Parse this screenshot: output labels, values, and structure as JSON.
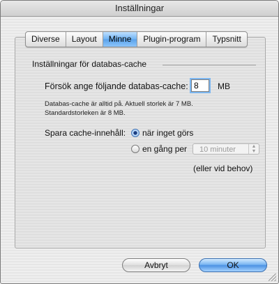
{
  "window": {
    "title": "Inställningar"
  },
  "tabs": [
    {
      "label": "Diverse",
      "active": false
    },
    {
      "label": "Layout",
      "active": false
    },
    {
      "label": "Minne",
      "active": true
    },
    {
      "label": "Plugin-program",
      "active": false
    },
    {
      "label": "Typsnitt",
      "active": false
    }
  ],
  "db_cache": {
    "group_title": "Inställningar för databas-cache",
    "size_label": "Försök ange följande databas-cache:",
    "size_value": "8",
    "size_unit": "MB",
    "info_line1": "Databas-cache är alltid på.  Aktuell storlek är 7 MB.",
    "info_line2": "Standardstorleken är 8 MB.",
    "save_label": "Spara cache-innehåll:",
    "option_idle": "när inget görs",
    "option_interval": "en gång per",
    "interval_value": "10 minuter",
    "needed_note": "(eller vid behov)",
    "selected_option": "idle"
  },
  "buttons": {
    "cancel": "Avbryt",
    "ok": "OK"
  },
  "colors": {
    "accent": "#5aa2ea",
    "window_bg": "#ececec"
  }
}
